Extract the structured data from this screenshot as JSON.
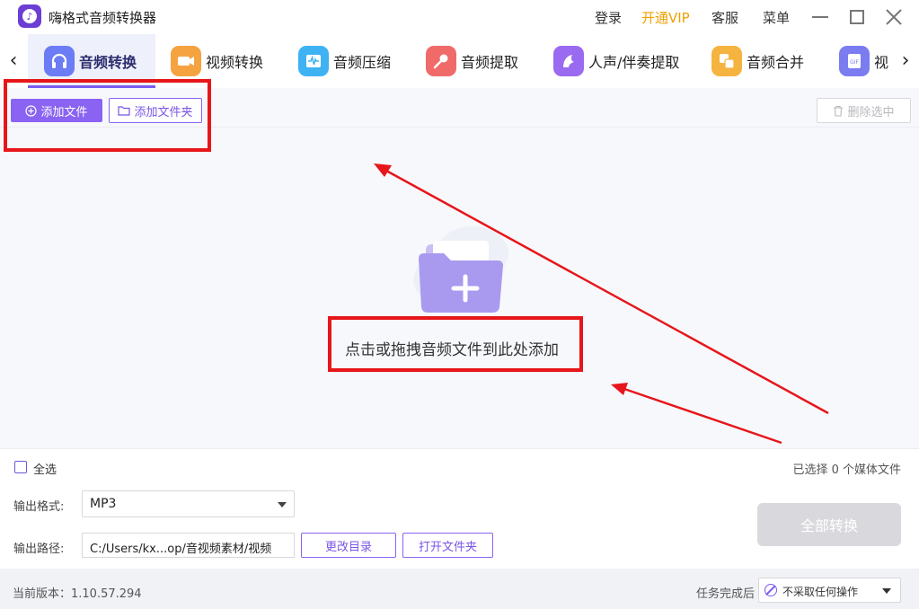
{
  "app": {
    "title": "嗨格式音频转换器",
    "logo_icon": "music-note-icon",
    "brand_color": "#7b5cf0"
  },
  "topbar": {
    "login": "登录",
    "vip": "开通VIP",
    "service": "客服",
    "menu": "菜单"
  },
  "tabs": [
    {
      "label": "音频转换",
      "icon": "headphones-icon",
      "color": "#6b7cf4",
      "active": true
    },
    {
      "label": "视频转换",
      "icon": "video-camera-icon",
      "color": "#f5a340"
    },
    {
      "label": "音频压缩",
      "icon": "waveform-icon",
      "color": "#3fb2f3"
    },
    {
      "label": "音频提取",
      "icon": "microphone-icon",
      "color": "#f06a6a"
    },
    {
      "label": "人声/伴奏提取",
      "icon": "vocal-icon",
      "color": "#9a6af0"
    },
    {
      "label": "音频合并",
      "icon": "merge-icon",
      "color": "#f5b340"
    },
    {
      "label": "视",
      "icon": "gif-icon",
      "color": "#7a7cf0"
    }
  ],
  "toolbar": {
    "add_file": "添加文件",
    "add_folder": "添加文件夹",
    "delete_selected": "删除选中"
  },
  "droparea": {
    "hint": "点击或拖拽音频文件到此处添加"
  },
  "selection": {
    "select_all": "全选",
    "count_text": "已选择 0 个媒体文件"
  },
  "output": {
    "format_label": "输出格式:",
    "format_value": "MP3",
    "path_label": "输出路径:",
    "path_value": "C:/Users/kx...op/音视频素材/视频",
    "change_dir": "更改目录",
    "open_folder": "打开文件夹",
    "convert_all": "全部转换"
  },
  "footer": {
    "version": "当前版本：1.10.57.294",
    "after_label": "任务完成后",
    "after_value": "不采取任何操作"
  }
}
